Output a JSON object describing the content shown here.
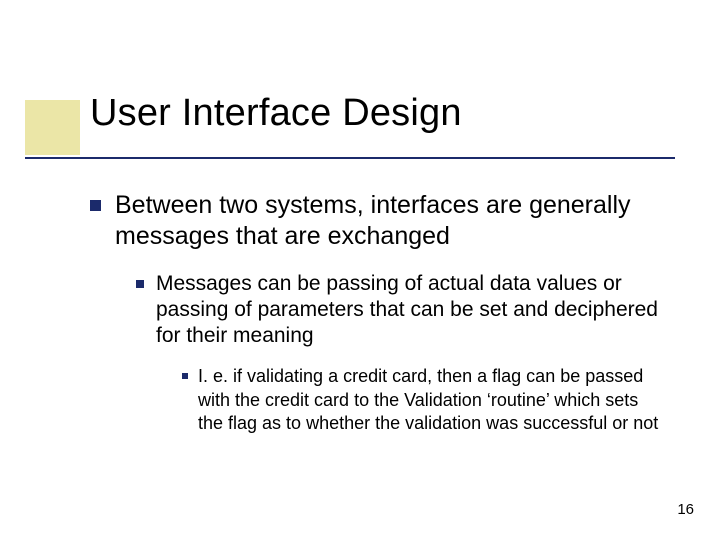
{
  "slide": {
    "title": "User Interface Design",
    "bullets": {
      "lvl1": "Between two systems, interfaces are generally messages that are exchanged",
      "lvl2": "Messages can be passing of actual data values or passing of parameters that can be set and deciphered for their meaning",
      "lvl3": "I. e. if validating a credit card, then a flag can be passed with the credit card to the Validation ‘routine’ which sets the flag as to whether the validation was successful or not"
    },
    "page_number": "16"
  }
}
